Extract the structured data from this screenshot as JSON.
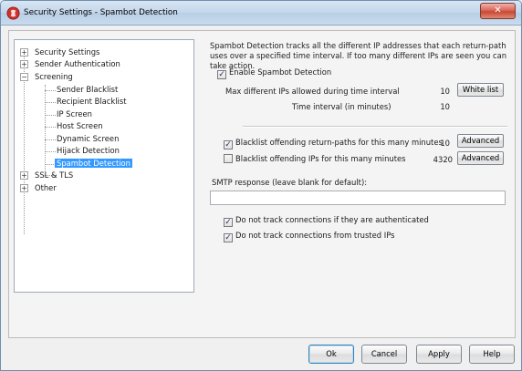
{
  "window": {
    "title": "Security Settings - Spambot Detection",
    "close_label": "✕"
  },
  "tree": {
    "items": [
      {
        "label": "Security Settings",
        "expander": "+"
      },
      {
        "label": "Sender Authentication",
        "expander": "+"
      },
      {
        "label": "Screening",
        "expander": "−"
      },
      {
        "label": "Sender Blacklist"
      },
      {
        "label": "Recipient Blacklist"
      },
      {
        "label": "IP Screen"
      },
      {
        "label": "Host Screen"
      },
      {
        "label": "Dynamic Screen"
      },
      {
        "label": "Hijack Detection"
      },
      {
        "label": "Spambot Detection",
        "selected": true
      },
      {
        "label": "SSL & TLS",
        "expander": "+"
      },
      {
        "label": "Other",
        "expander": "+"
      }
    ]
  },
  "spambot": {
    "description": "Spambot Detection tracks all the different IP addresses that each return-path uses over a specified time interval.  If too many different IPs are seen you can take action.",
    "enable_label": "Enable Spambot Detection",
    "enable_checked": true,
    "max_ips_label": "Max different IPs allowed during time interval",
    "max_ips_value": "10",
    "white_list_label": "White list",
    "interval_label": "Time interval (in minutes)",
    "interval_value": "10",
    "blacklist_paths_label": "Blacklist offending return-paths for this many minutes",
    "blacklist_paths_checked": true,
    "blacklist_paths_value": "10",
    "blacklist_ips_label": "Blacklist offending IPs for this many minutes",
    "blacklist_ips_checked": false,
    "blacklist_ips_value": "4320",
    "advanced_label": "Advanced",
    "smtp_label": "SMTP response (leave blank for default):",
    "smtp_value": "",
    "no_track_auth_label": "Do not track connections if they are authenticated",
    "no_track_auth_checked": true,
    "no_track_trusted_label": "Do not track connections from trusted IPs",
    "no_track_trusted_checked": true
  },
  "footer": {
    "ok_label": "Ok",
    "cancel_label": "Cancel",
    "apply_label": "Apply",
    "help_label": "Help"
  },
  "colors": {
    "selection": "#3399ff",
    "close_button": "#c94734",
    "icon_red": "#d3322b"
  },
  "icons": {
    "app": "security-shield-icon",
    "checked": "checkmark-icon"
  }
}
